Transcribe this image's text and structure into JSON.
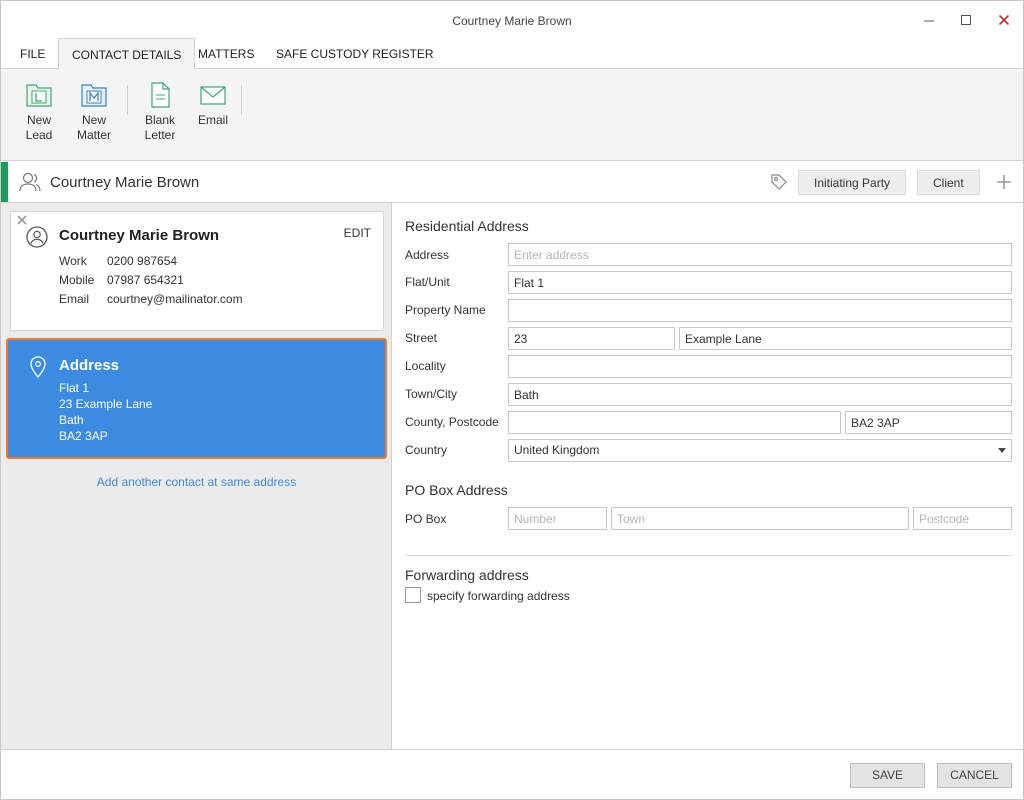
{
  "window": {
    "title": "Courtney Marie Brown"
  },
  "tabs": [
    {
      "label": "FILE"
    },
    {
      "label": "CONTACT DETAILS"
    },
    {
      "label": "MATTERS"
    },
    {
      "label": "SAFE CUSTODY REGISTER"
    }
  ],
  "ribbon": {
    "new_lead": {
      "line1": "New",
      "line2": "Lead",
      "icon": "new-lead-icon"
    },
    "new_matter": {
      "line1": "New",
      "line2": "Matter",
      "icon": "new-matter-icon"
    },
    "blank_letter": {
      "line1": "Blank",
      "line2": "Letter",
      "icon": "blank-letter-icon"
    },
    "email": {
      "line1": "Email",
      "icon": "email-icon"
    }
  },
  "header": {
    "name": "Courtney Marie Brown",
    "tags": [
      "Initiating Party",
      "Client"
    ],
    "accent": "#1e9b5b"
  },
  "card": {
    "name": "Courtney Marie Brown",
    "edit": "EDIT",
    "phones": [
      {
        "label": "Work",
        "value": "0200 987654"
      },
      {
        "label": "Mobile",
        "value": "07987 654321"
      },
      {
        "label": "Email",
        "value": "courtney@mailinator.com"
      }
    ]
  },
  "address_card": {
    "title": "Address",
    "lines": [
      "Flat 1",
      "23 Example Lane",
      "Bath",
      "BA2 3AP"
    ],
    "color": "#3b8be0",
    "selected_border": "#f07a2a"
  },
  "add_link": "Add another contact at same address",
  "residential": {
    "title": "Residential Address",
    "address": {
      "label": "Address",
      "value": "",
      "placeholder": "Enter address"
    },
    "flat": {
      "label": "Flat/Unit",
      "value": "Flat 1"
    },
    "property": {
      "label": "Property Name",
      "value": ""
    },
    "street": {
      "label": "Street",
      "number": "23",
      "name": "Example Lane"
    },
    "locality": {
      "label": "Locality",
      "value": ""
    },
    "town": {
      "label": "Town/City",
      "value": "Bath"
    },
    "county_postcode": {
      "label": "County, Postcode",
      "county": "",
      "postcode": "BA2 3AP"
    },
    "country": {
      "label": "Country",
      "value": "United Kingdom"
    }
  },
  "pobox": {
    "title": "PO Box Address",
    "label": "PO Box",
    "number_placeholder": "Number",
    "town_placeholder": "Town",
    "postcode_placeholder": "Postcode"
  },
  "forwarding": {
    "title": "Forwarding address",
    "checkbox_label": "specify forwarding address",
    "checked": false
  },
  "footer": {
    "save": "SAVE",
    "cancel": "CANCEL"
  }
}
